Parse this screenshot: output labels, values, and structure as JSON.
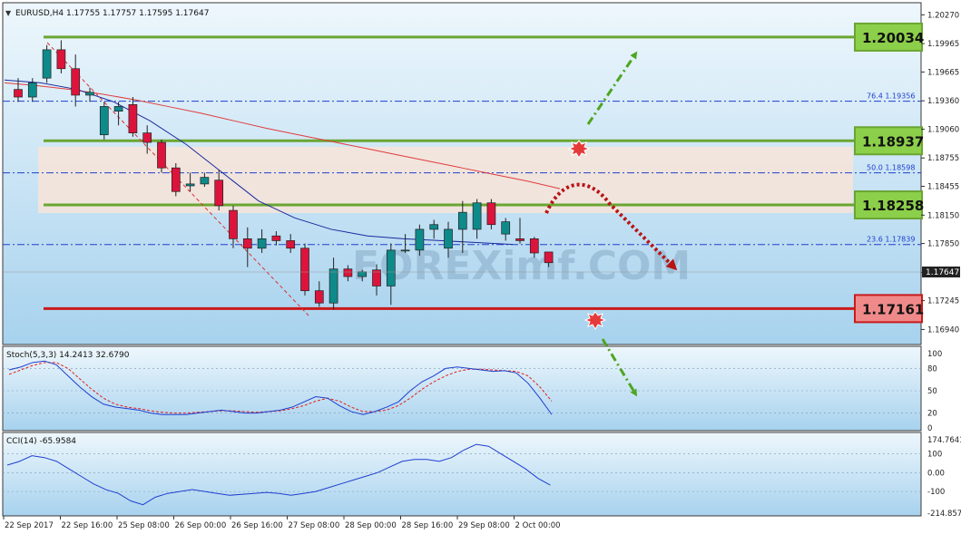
{
  "colors": {
    "background_top": "#e9f4fb",
    "background_bottom": "#a9d3ee",
    "bull_candle": "#0f8a8a",
    "bear_candle": "#dc143c",
    "ma_slow": "#e23c3c",
    "ma_fast": "#1c2a9c",
    "level_green": "#6aa532",
    "level_red": "#c81b1b",
    "box_green_fill": "#8ccf4a",
    "box_red_fill": "#f08a8a",
    "zone_fill": "#f7e4d8",
    "fibo": "#1f3fcf",
    "stoch_main": "#1f3fcf",
    "stoch_signal": "#e02020",
    "cci_line": "#1f3fcf",
    "arrow_green": "#4ea51f",
    "arrow_red": "#b81414"
  },
  "header": {
    "label": "EURUSD,H4  1.17755 1.17757 1.17595 1.17647"
  },
  "watermark": "FOREXimf.COM",
  "chart_data": [
    {
      "type": "candlestick",
      "symbol": "EURUSD",
      "timeframe": "H4",
      "ohlc_label": "1.17755 1.17757 1.17595 1.17647",
      "ylim": [
        1.168,
        1.2035
      ],
      "y_ticks": [
        "1.20270",
        "1.19965",
        "1.19665",
        "1.19360",
        "1.19060",
        "1.18755",
        "1.18455",
        "1.18150",
        "1.17850",
        "1.17545",
        "1.17245",
        "1.16940"
      ],
      "x_ticks": [
        "22 Sep 2017",
        "22 Sep 16:00",
        "25 Sep 08:00",
        "26 Sep 00:00",
        "26 Sep 16:00",
        "27 Sep 08:00",
        "28 Sep 00:00",
        "28 Sep 16:00",
        "29 Sep 08:00",
        "2 Oct 00:00"
      ],
      "current_price": "1.17647",
      "candles": [
        {
          "o": 1.1948,
          "h": 1.196,
          "l": 1.1935,
          "c": 1.194
        },
        {
          "o": 1.194,
          "h": 1.196,
          "l": 1.1935,
          "c": 1.1955
        },
        {
          "o": 1.196,
          "h": 1.1995,
          "l": 1.1955,
          "c": 1.199
        },
        {
          "o": 1.199,
          "h": 1.2,
          "l": 1.1965,
          "c": 1.197
        },
        {
          "o": 1.197,
          "h": 1.1985,
          "l": 1.193,
          "c": 1.1942
        },
        {
          "o": 1.1942,
          "h": 1.195,
          "l": 1.1935,
          "c": 1.1945
        },
        {
          "o": 1.19,
          "h": 1.1935,
          "l": 1.1895,
          "c": 1.193
        },
        {
          "o": 1.1925,
          "h": 1.1935,
          "l": 1.191,
          "c": 1.193
        },
        {
          "o": 1.1932,
          "h": 1.194,
          "l": 1.1898,
          "c": 1.1902
        },
        {
          "o": 1.1902,
          "h": 1.191,
          "l": 1.188,
          "c": 1.1892
        },
        {
          "o": 1.1892,
          "h": 1.1895,
          "l": 1.186,
          "c": 1.1865
        },
        {
          "o": 1.1865,
          "h": 1.187,
          "l": 1.1835,
          "c": 1.184
        },
        {
          "o": 1.1846,
          "h": 1.186,
          "l": 1.184,
          "c": 1.1848
        },
        {
          "o": 1.1848,
          "h": 1.186,
          "l": 1.1845,
          "c": 1.1855
        },
        {
          "o": 1.1852,
          "h": 1.1863,
          "l": 1.182,
          "c": 1.1825
        },
        {
          "o": 1.182,
          "h": 1.1825,
          "l": 1.178,
          "c": 1.179
        },
        {
          "o": 1.179,
          "h": 1.1802,
          "l": 1.176,
          "c": 1.178
        },
        {
          "o": 1.178,
          "h": 1.18,
          "l": 1.1775,
          "c": 1.179
        },
        {
          "o": 1.1793,
          "h": 1.1798,
          "l": 1.1783,
          "c": 1.1788
        },
        {
          "o": 1.1788,
          "h": 1.1795,
          "l": 1.1775,
          "c": 1.178
        },
        {
          "o": 1.178,
          "h": 1.1785,
          "l": 1.173,
          "c": 1.1735
        },
        {
          "o": 1.1735,
          "h": 1.1745,
          "l": 1.1718,
          "c": 1.1722
        },
        {
          "o": 1.1722,
          "h": 1.177,
          "l": 1.1715,
          "c": 1.1758
        },
        {
          "o": 1.1758,
          "h": 1.1762,
          "l": 1.1745,
          "c": 1.175
        },
        {
          "o": 1.175,
          "h": 1.1757,
          "l": 1.1745,
          "c": 1.1755
        },
        {
          "o": 1.1757,
          "h": 1.1763,
          "l": 1.173,
          "c": 1.174
        },
        {
          "o": 1.174,
          "h": 1.1785,
          "l": 1.172,
          "c": 1.1778
        },
        {
          "o": 1.1778,
          "h": 1.1795,
          "l": 1.1775,
          "c": 1.1778
        },
        {
          "o": 1.1778,
          "h": 1.1805,
          "l": 1.1772,
          "c": 1.18
        },
        {
          "o": 1.18,
          "h": 1.181,
          "l": 1.179,
          "c": 1.1805
        },
        {
          "o": 1.178,
          "h": 1.1808,
          "l": 1.177,
          "c": 1.18
        },
        {
          "o": 1.18,
          "h": 1.183,
          "l": 1.1775,
          "c": 1.1818
        },
        {
          "o": 1.18,
          "h": 1.1832,
          "l": 1.179,
          "c": 1.1828
        },
        {
          "o": 1.1828,
          "h": 1.1832,
          "l": 1.18,
          "c": 1.1805
        },
        {
          "o": 1.1795,
          "h": 1.1812,
          "l": 1.1788,
          "c": 1.1808
        },
        {
          "o": 1.179,
          "h": 1.1812,
          "l": 1.1785,
          "c": 1.1788
        },
        {
          "o": 1.179,
          "h": 1.1792,
          "l": 1.177,
          "c": 1.1775
        },
        {
          "o": 1.1776,
          "h": 1.1776,
          "l": 1.176,
          "c": 1.17647
        }
      ],
      "ma_slow": [
        1.1955,
        1.1952,
        1.1948,
        1.1943,
        1.1937,
        1.193,
        1.1923,
        1.1915,
        1.1907,
        1.19,
        1.1893,
        1.1886,
        1.1879,
        1.1872,
        1.1865,
        1.1858,
        1.1851,
        1.1843
      ],
      "ma_fast": [
        1.1958,
        1.1955,
        1.1948,
        1.1935,
        1.1915,
        1.189,
        1.186,
        1.183,
        1.1812,
        1.18,
        1.1793,
        1.179,
        1.1788,
        1.1786,
        1.1784
      ],
      "levels": [
        {
          "label": "1.20034",
          "price": 1.20034,
          "kind": "green"
        },
        {
          "label": "1.18937",
          "price": 1.18937,
          "kind": "green"
        },
        {
          "label": "1.18258",
          "price": 1.18258,
          "kind": "green"
        },
        {
          "label": "1.17161",
          "price": 1.17161,
          "kind": "red"
        }
      ],
      "fibo": [
        {
          "ratio": "76.4",
          "price": 1.19356,
          "label": "76.4   1.19356"
        },
        {
          "ratio": "50.0",
          "price": 1.18598,
          "label": "50.0   1.18598"
        },
        {
          "ratio": "23.6",
          "price": 1.17839,
          "label": "23.6   1.17839"
        }
      ]
    },
    {
      "type": "line",
      "label": "Stoch(5,3,3) 14.2413 32.6790",
      "ylim": [
        0,
        100
      ],
      "y_ticks": [
        "100",
        "80",
        "50",
        "20",
        "0"
      ],
      "series": [
        {
          "values": [
            78,
            82,
            88,
            90,
            85,
            70,
            55,
            42,
            32,
            28,
            26,
            24,
            20,
            18,
            18,
            18,
            20,
            22,
            24,
            22,
            20,
            20,
            22,
            24,
            28,
            35,
            42,
            40,
            30,
            22,
            18,
            22,
            28,
            35,
            50,
            62,
            70,
            80,
            82,
            80,
            78,
            76,
            77,
            74,
            60,
            40,
            18
          ]
        },
        {
          "values": [
            72,
            78,
            84,
            88,
            88,
            80,
            66,
            52,
            40,
            32,
            28,
            26,
            23,
            21,
            20,
            20,
            21,
            22,
            23,
            23,
            22,
            21,
            22,
            23,
            26,
            30,
            36,
            40,
            36,
            28,
            22,
            22,
            24,
            30,
            40,
            52,
            62,
            70,
            76,
            79,
            79,
            78,
            77,
            76,
            70,
            55,
            36
          ]
        }
      ]
    },
    {
      "type": "line",
      "label": "CCI(14) -65.9584",
      "ylim": [
        -214.8574,
        174.7641
      ],
      "y_ticks": [
        "174.7641",
        "100",
        "0.00",
        "-100",
        "-214.8574"
      ],
      "series": [
        {
          "values": [
            40,
            60,
            90,
            80,
            60,
            20,
            -20,
            -60,
            -90,
            -110,
            -150,
            -170,
            -130,
            -110,
            -100,
            -90,
            -100,
            -110,
            -120,
            -115,
            -110,
            -105,
            -110,
            -120,
            -110,
            -100,
            -80,
            -60,
            -40,
            -20,
            0,
            30,
            60,
            70,
            70,
            60,
            80,
            120,
            150,
            140,
            100,
            60,
            20,
            -30,
            -66
          ]
        }
      ]
    }
  ]
}
